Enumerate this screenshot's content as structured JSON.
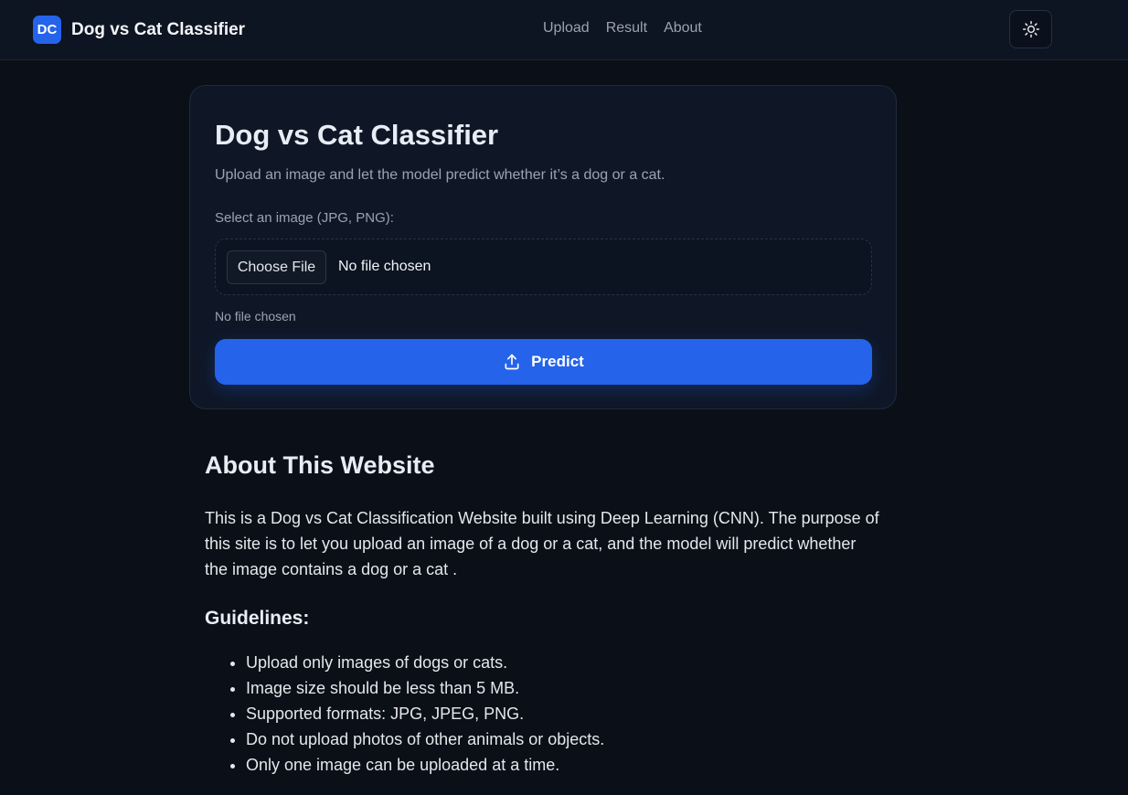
{
  "header": {
    "logo_text": "DC",
    "title": "Dog vs Cat Classifier",
    "nav": [
      "Upload",
      "Result",
      "About"
    ],
    "theme_toggle_icon": "sun-icon"
  },
  "card": {
    "title": "Dog vs Cat Classifier",
    "subtitle": "Upload an image and let the model predict whether it’s a dog or a cat.",
    "select_label": "Select an image (JPG, PNG):",
    "choose_file_label": "Choose File",
    "file_status": "No file chosen",
    "file_note": "No file chosen",
    "predict_label": "Predict",
    "predict_icon": "upload-icon"
  },
  "about": {
    "title": "About This Website",
    "description": "This is a Dog vs Cat Classification Website built using Deep Learning (CNN). The purpose of this site is to let you upload an image of a dog or a cat, and the model will predict whether the image contains a dog or a cat .",
    "guidelines_title": "Guidelines:",
    "guidelines": [
      "Upload only images of dogs or cats.",
      "Image size should be less than 5 MB.",
      "Supported formats: JPG, JPEG, PNG.",
      "Do not upload photos of other animals or objects.",
      "Only one image can be uploaded at a time."
    ]
  },
  "colors": {
    "accent": "#2563eb",
    "background": "#0a0f18",
    "card_background": "#0f1727"
  }
}
